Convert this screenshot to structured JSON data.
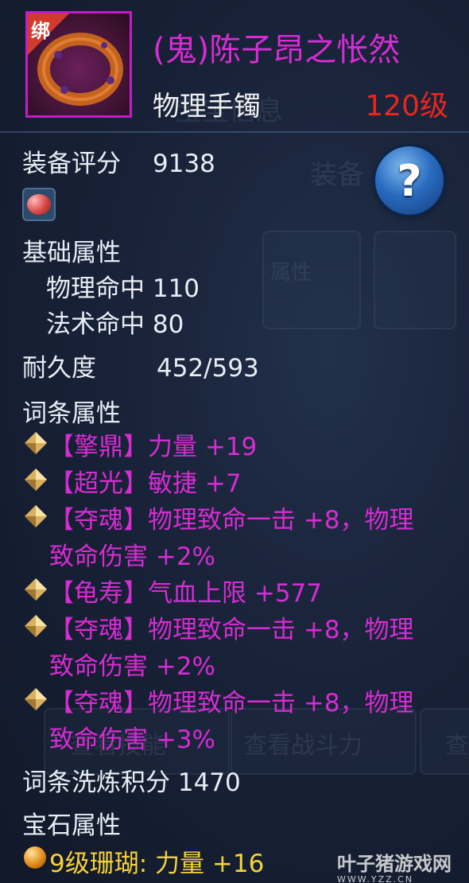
{
  "item": {
    "bind_badge": "绑",
    "name": "(鬼)陈子昂之怅然",
    "type": "物理手镯",
    "level": "120级"
  },
  "score": {
    "label": "装备评分",
    "value": "9138"
  },
  "base_attributes": {
    "title": "基础属性",
    "lines": [
      "物理命中 110",
      "法术命中 80"
    ]
  },
  "durability": {
    "label": "耐久度",
    "value": "452/593"
  },
  "affix": {
    "title": "词条属性",
    "lines": [
      [
        "【擎鼎】力量 +19"
      ],
      [
        "【超光】敏捷 +7"
      ],
      [
        "【夺魂】物理致命一击 +8，物理",
        "致命伤害 +2%"
      ],
      [
        "【龟寿】气血上限 +577"
      ],
      [
        "【夺魂】物理致命一击 +8，物理",
        "致命伤害 +2%"
      ],
      [
        "【夺魂】物理致命一击 +8，物理",
        "致命伤害 +3%"
      ]
    ]
  },
  "refine": {
    "label": "词条洗炼积分",
    "value": "1470"
  },
  "gem": {
    "title": "宝石属性",
    "line": "9级珊瑚: 力量 +16"
  },
  "help_label": "?",
  "watermark": {
    "main": "叶子猪游戏网",
    "sub": "WWW.YZZ.CN"
  },
  "background_text": [
    "宝宝信息",
    "装备",
    "属性",
    "查看技能",
    "查看战斗力",
    "查"
  ],
  "colors": {
    "title": "#d62cd2",
    "level": "#e8261c",
    "gem_text": "#f4d23a",
    "frame": "#c01fc6"
  }
}
